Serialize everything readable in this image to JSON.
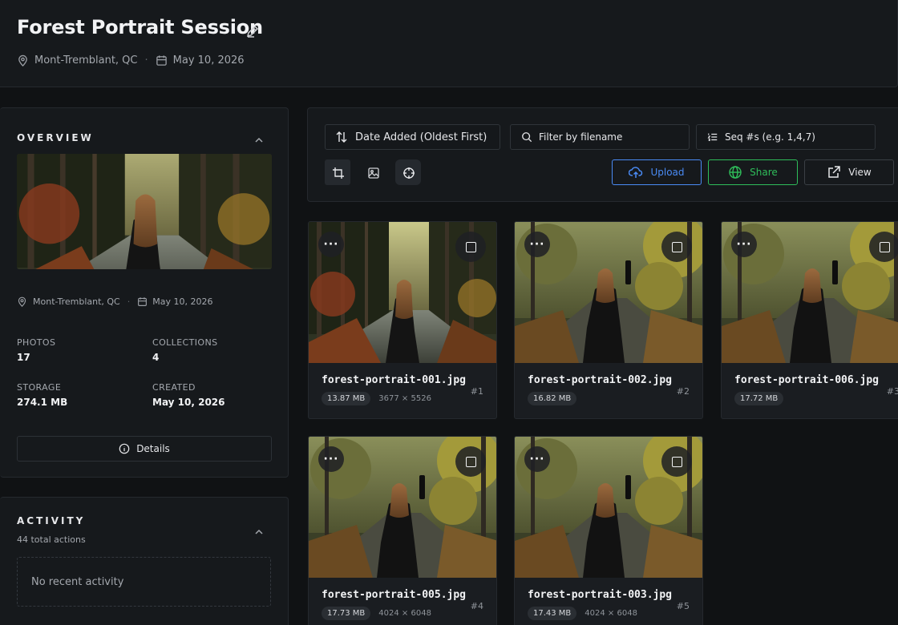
{
  "header": {
    "title": "Forest Portrait Session",
    "location": "Mont-Tremblant, QC",
    "date": "May 10, 2026"
  },
  "overview": {
    "title": "OVERVIEW",
    "location": "Mont-Tremblant, QC",
    "date": "May 10, 2026",
    "stats": {
      "photos_label": "PHOTOS",
      "photos": "17",
      "collections_label": "COLLECTIONS",
      "collections": "4",
      "storage_label": "STORAGE",
      "storage": "274.1 MB",
      "created_label": "CREATED",
      "created": "May 10, 2026"
    },
    "details_label": "Details"
  },
  "activity": {
    "title": "ACTIVITY",
    "subtitle": "44 total actions",
    "empty_text": "No recent activity"
  },
  "toolbar": {
    "sort_label": "Date Added (Oldest First)",
    "filter_placeholder": "Filter by filename",
    "seq_placeholder": "Seq #s (e.g. 1,4,7)",
    "upload_label": "Upload",
    "share_label": "Share",
    "view_label": "View",
    "colors": {
      "upload": "#4a8bf5",
      "share": "#2fbd5a"
    }
  },
  "photos": [
    {
      "filename": "forest-portrait-001.jpg",
      "size": "13.87 MB",
      "dims": "3677 × 5526",
      "seq": "#1"
    },
    {
      "filename": "forest-portrait-002.jpg",
      "size": "16.82 MB",
      "dims": "",
      "seq": "#2"
    },
    {
      "filename": "forest-portrait-006.jpg",
      "size": "17.72 MB",
      "dims": "",
      "seq": "#3"
    },
    {
      "filename": "forest-portrait-005.jpg",
      "size": "17.73 MB",
      "dims": "4024 × 6048",
      "seq": "#4"
    },
    {
      "filename": "forest-portrait-003.jpg",
      "size": "17.43 MB",
      "dims": "4024 × 6048",
      "seq": "#5"
    }
  ]
}
